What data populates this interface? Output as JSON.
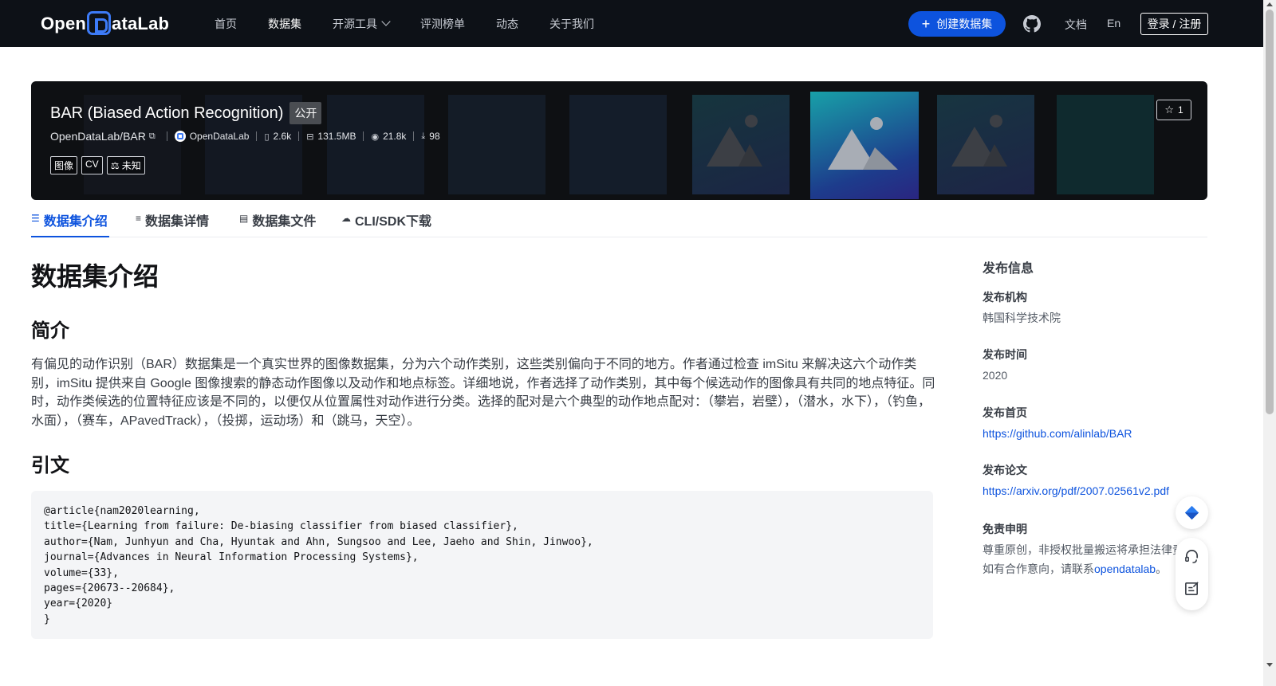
{
  "header": {
    "logo_prefix": "Open",
    "logo_suffix": "ataLab",
    "nav": [
      {
        "label": "首页",
        "active": false
      },
      {
        "label": "数据集",
        "active": true
      },
      {
        "label": "开源工具",
        "active": false,
        "has_dropdown": true
      },
      {
        "label": "评测榜单",
        "active": false
      },
      {
        "label": "动态",
        "active": false
      },
      {
        "label": "关于我们",
        "active": false
      }
    ],
    "create_button": "创建数据集",
    "github_icon": "github-icon",
    "docs_link": "文档",
    "lang_link": "En",
    "login_button": "登录 / 注册"
  },
  "dataset": {
    "title": "BAR (Biased Action Recognition)",
    "visibility_badge": "公开",
    "path": "OpenDataLab/BAR",
    "publisher": "OpenDataLab",
    "files_count": "2.6k",
    "size": "131.5MB",
    "views": "21.8k",
    "downloads": "98",
    "tags": [
      "图像",
      "CV",
      "未知"
    ],
    "stars": "1"
  },
  "tabs": [
    {
      "label": "数据集介绍",
      "icon": "database-icon",
      "active": true
    },
    {
      "label": "数据集详情",
      "icon": "list-icon",
      "active": false
    },
    {
      "label": "数据集文件",
      "icon": "file-icon",
      "active": false
    },
    {
      "label": "CLI/SDK下载",
      "icon": "cloud-icon",
      "active": false
    }
  ],
  "content": {
    "heading": "数据集介绍",
    "summary_heading": "简介",
    "summary_text": "有偏见的动作识别（BAR）数据集是一个真实世界的图像数据集，分为六个动作类别，这些类别偏向于不同的地方。作者通过检查 imSitu 来解决这六个动作类别，imSitu 提供来自 Google 图像搜索的静态动作图像以及动作和地点标签。详细地说，作者选择了动作类别，其中每个候选动作的图像具有共同的地点特征。同时，动作类候选的位置特征应该是不同的，以便仅从位置属性对动作进行分类。选择的配对是六个典型的动作地点配对：（攀岩，岩壁），（潜水，水下），（钓鱼，水面），（赛车，APavedTrack），（投掷，运动场）和（跳马，天空）。",
    "citation_heading": "引文",
    "citation_code": "@article{nam2020learning,\ntitle={Learning from failure: De-biasing classifier from biased classifier},\nauthor={Nam, Junhyun and Cha, Hyuntak and Ahn, Sungsoo and Lee, Jaeho and Shin, Jinwoo},\njournal={Advances in Neural Information Processing Systems},\nvolume={33},\npages={20673--20684},\nyear={2020}\n}"
  },
  "sidebar": {
    "title": "发布信息",
    "org_label": "发布机构",
    "org_value": "韩国科学技术院",
    "time_label": "发布时间",
    "time_value": "2020",
    "homepage_label": "发布首页",
    "homepage_value": "https://github.com/alinlab/BAR",
    "paper_label": "发布论文",
    "paper_value": "https://arxiv.org/pdf/2007.02561v2.pdf",
    "disclaimer_label": "免责申明",
    "disclaimer_line1": "尊重原创，非授权批量搬运将承担法律责",
    "disclaimer_line2_prefix": "如有合作意向，请联系",
    "disclaimer_link": "opendatalab",
    "disclaimer_line2_suffix": "。"
  },
  "colors": {
    "header_bg": "#0d1117",
    "accent": "#0d53de"
  }
}
